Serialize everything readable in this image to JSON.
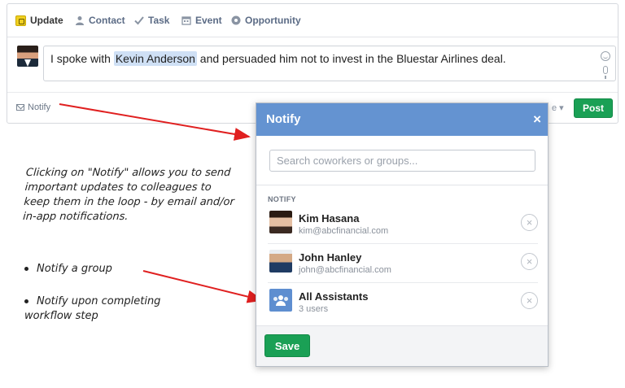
{
  "composer": {
    "tabs": [
      {
        "label": "Update",
        "icon": "note-icon"
      },
      {
        "label": "Contact",
        "icon": "person-icon"
      },
      {
        "label": "Task",
        "icon": "check-icon"
      },
      {
        "label": "Event",
        "icon": "calendar-icon"
      },
      {
        "label": "Opportunity",
        "icon": "target-icon"
      }
    ],
    "message_before": "I spoke with ",
    "mention": "Kevin Anderson",
    "message_after": " and persuaded him not to invest in the Bluestar Airlines deal.",
    "notify_label": "Notify",
    "visibility_hint": "e",
    "post_label": "Post"
  },
  "dialog": {
    "title": "Notify",
    "close": "×",
    "search_placeholder": "Search coworkers or groups...",
    "section_label": "NOTIFY",
    "recipients": [
      {
        "name": "Kim Hasana",
        "detail": "kim@abcfinancial.com"
      },
      {
        "name": "John Hanley",
        "detail": "john@abcfinancial.com"
      },
      {
        "name": "All Assistants",
        "detail": "3 users"
      }
    ],
    "remove_glyph": "×",
    "save_label": "Save"
  },
  "annotations": {
    "main": "Clicking on \"Notify\" allows you to send important updates to colleagues to keep them in the loop - by email and/or in-app notifications.",
    "bullet_1": "Notify a group",
    "bullet_2_line1": "Notify upon completing",
    "bullet_2_line2": "workflow step"
  },
  "colors": {
    "header_blue": "#6493d1",
    "post_green": "#1aa055",
    "arrow_red": "#e02020",
    "mention_bg": "#cfe0f5"
  }
}
